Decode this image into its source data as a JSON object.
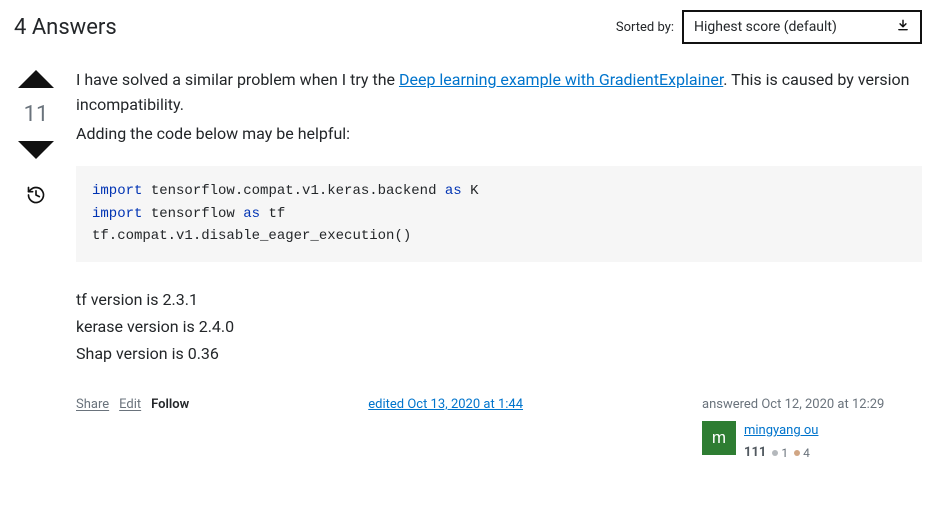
{
  "header": {
    "title": "4 Answers",
    "sort_label": "Sorted by:",
    "sort_selected": "Highest score (default)"
  },
  "vote": {
    "count": "11"
  },
  "answer": {
    "text_before_link": "I have solved a similar problem when I try the ",
    "link_text": "Deep learning example with GradientExplainer",
    "text_after_link": ". This is caused by version incompatibility.",
    "line2": "Adding the code below may be helpful:",
    "code": {
      "l1a": "import",
      "l1b": " tensorflow.compat.v1.keras.backend ",
      "l1c": "as",
      "l1d": " K",
      "l2a": "import",
      "l2b": " tensorflow ",
      "l2c": "as",
      "l2d": " tf",
      "l3": "tf.compat.v1.disable_eager_execution()"
    },
    "versions": {
      "v1": "tf version is 2.3.1",
      "v2": "kerase version is 2.4.0",
      "v3": "Shap version is 0.36"
    }
  },
  "actions": {
    "share": "Share",
    "edit": "Edit",
    "follow": "Follow"
  },
  "edited": {
    "text": "edited Oct 13, 2020 at 1:44"
  },
  "usercard": {
    "answered": "answered Oct 12, 2020 at 12:29",
    "avatar_letter": "m",
    "username": "mingyang ou",
    "rep": "111",
    "silver": "1",
    "bronze": "4"
  }
}
